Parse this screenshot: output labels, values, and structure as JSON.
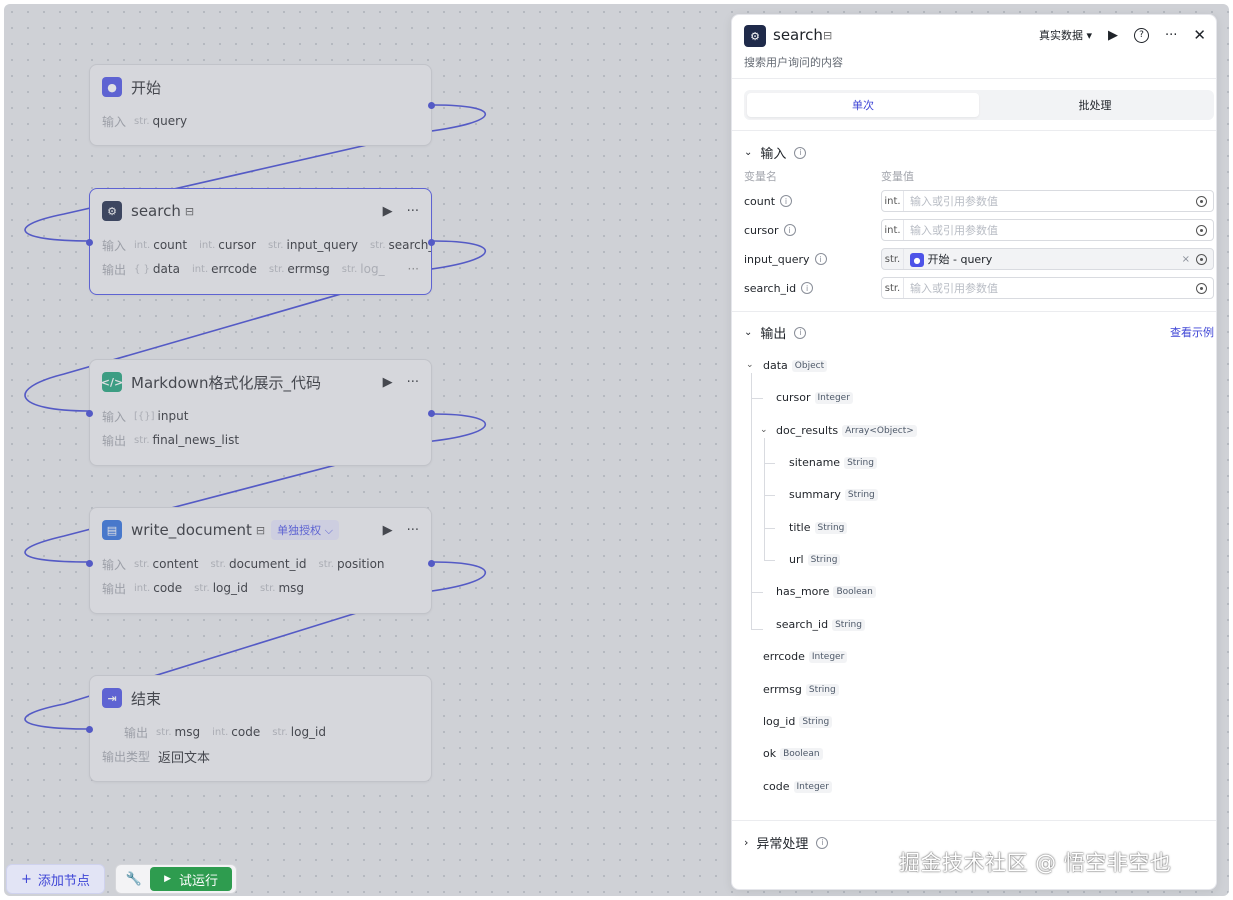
{
  "canvas": {
    "nodes": {
      "start": {
        "title": "开始",
        "input_label": "输入",
        "inputs": [
          {
            "type": "str.",
            "name": "query"
          }
        ]
      },
      "search": {
        "title": "search",
        "input_label": "输入",
        "output_label": "输出",
        "inputs": [
          {
            "type": "int.",
            "name": "count"
          },
          {
            "type": "int.",
            "name": "cursor"
          },
          {
            "type": "str.",
            "name": "input_query"
          },
          {
            "type": "str.",
            "name": "search_id"
          }
        ],
        "outputs": [
          {
            "type": "{ }",
            "name": "data"
          },
          {
            "type": "int.",
            "name": "errcode"
          },
          {
            "type": "str.",
            "name": "errmsg"
          },
          {
            "type": "str.",
            "name": "log_"
          }
        ],
        "more": "···"
      },
      "markdown": {
        "title": "Markdown格式化展示_代码",
        "input_label": "输入",
        "output_label": "输出",
        "inputs": [
          {
            "type": "[{}]",
            "name": "input"
          }
        ],
        "outputs": [
          {
            "type": "str.",
            "name": "final_news_list"
          }
        ]
      },
      "write": {
        "title": "write_document",
        "badge": "单独授权 ⌵",
        "input_label": "输入",
        "output_label": "输出",
        "inputs": [
          {
            "type": "str.",
            "name": "content"
          },
          {
            "type": "str.",
            "name": "document_id"
          },
          {
            "type": "str.",
            "name": "position"
          }
        ],
        "outputs": [
          {
            "type": "int.",
            "name": "code"
          },
          {
            "type": "str.",
            "name": "log_id"
          },
          {
            "type": "str.",
            "name": "msg"
          }
        ]
      },
      "end": {
        "title": "结束",
        "output_label": "输出",
        "outputs": [
          {
            "type": "str.",
            "name": "msg"
          },
          {
            "type": "int.",
            "name": "code"
          },
          {
            "type": "str.",
            "name": "log_id"
          }
        ],
        "output_type_label": "输出类型",
        "output_type_value": "返回文本"
      }
    },
    "bottom_bar": {
      "add_node": "添加节点",
      "test_run": "试运行"
    }
  },
  "panel": {
    "title": "search",
    "description": "搜索用户询问的内容",
    "data_select": "真实数据 ▾",
    "tabs": [
      {
        "label": "单次",
        "active": true
      },
      {
        "label": "批处理",
        "active": false
      }
    ],
    "input_section": {
      "title": "输入",
      "col_name": "变量名",
      "col_value": "变量值",
      "rows": [
        {
          "name": "count",
          "type": "int.",
          "placeholder": "输入或引用参数值"
        },
        {
          "name": "cursor",
          "type": "int.",
          "placeholder": "输入或引用参数值"
        },
        {
          "name": "input_query",
          "type": "str.",
          "ref": "开始 - query"
        },
        {
          "name": "search_id",
          "type": "str.",
          "placeholder": "输入或引用参数值"
        }
      ]
    },
    "output_section": {
      "title": "输出",
      "view_example": "查看示例",
      "tree": {
        "data": {
          "name": "data",
          "type": "Object"
        },
        "cursor": {
          "name": "cursor",
          "type": "Integer"
        },
        "doc_results": {
          "name": "doc_results",
          "type": "Array<Object>"
        },
        "sitename": {
          "name": "sitename",
          "type": "String"
        },
        "summary": {
          "name": "summary",
          "type": "String"
        },
        "title": {
          "name": "title",
          "type": "String"
        },
        "url": {
          "name": "url",
          "type": "String"
        },
        "has_more": {
          "name": "has_more",
          "type": "Boolean"
        },
        "search_id": {
          "name": "search_id",
          "type": "String"
        },
        "errcode": {
          "name": "errcode",
          "type": "Integer"
        },
        "errmsg": {
          "name": "errmsg",
          "type": "String"
        },
        "log_id": {
          "name": "log_id",
          "type": "String"
        },
        "ok": {
          "name": "ok",
          "type": "Boolean"
        },
        "code": {
          "name": "code",
          "type": "Integer"
        }
      }
    },
    "exception_section": {
      "title": "异常处理"
    }
  },
  "watermark": "掘金技术社区 @ 悟空非空也",
  "colors": {
    "accent": "#4d53e8",
    "run_green": "#2e9c4f",
    "edge": "#3f46d6"
  },
  "icons": {
    "start": "play-circle-icon",
    "search": "plugin-icon",
    "markdown": "code-icon",
    "write": "document-icon",
    "end": "exit-icon"
  }
}
